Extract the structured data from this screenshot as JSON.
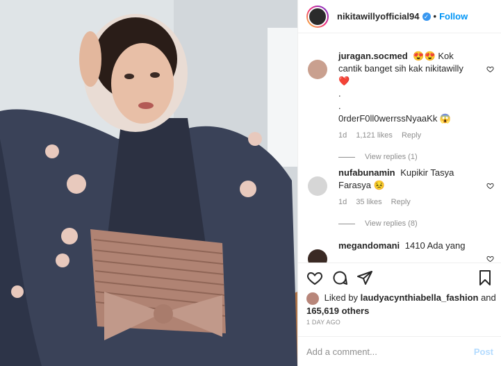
{
  "post": {
    "image_icon": "portrait-photo",
    "accent": "#0095f6"
  },
  "header": {
    "username": "nikitawillyofficial94",
    "verified_icon": "verified-badge",
    "separator": "•",
    "follow_label": "Follow"
  },
  "comments": [
    {
      "username": "juragan.socmed",
      "text_line1": "😍😍 Kok cantik banget sih kak nikitawilly",
      "emoji_heart": "❤️",
      "text_line2": ".",
      "text_line3": ".",
      "text_line4": "0rderF0ll0werrssNyaaKk 😱",
      "time": "1d",
      "likes": "1,121 likes",
      "reply_label": "Reply",
      "view_replies": "View replies (1)"
    },
    {
      "username": "nufabunamin",
      "text": "Kupikir Tasya Farasya 😣",
      "time": "1d",
      "likes": "35 likes",
      "reply_label": "Reply",
      "view_replies": "View replies (8)"
    },
    {
      "username": "megandomani",
      "text": "1410 Ada yang"
    }
  ],
  "liked_by": {
    "prefix": "Liked by",
    "user": "laudyacynthiabella_fashion",
    "connector": "and",
    "count": "165,619 others"
  },
  "timestamp": "1 DAY AGO",
  "add_comment": {
    "placeholder": "Add a comment...",
    "post_label": "Post"
  }
}
